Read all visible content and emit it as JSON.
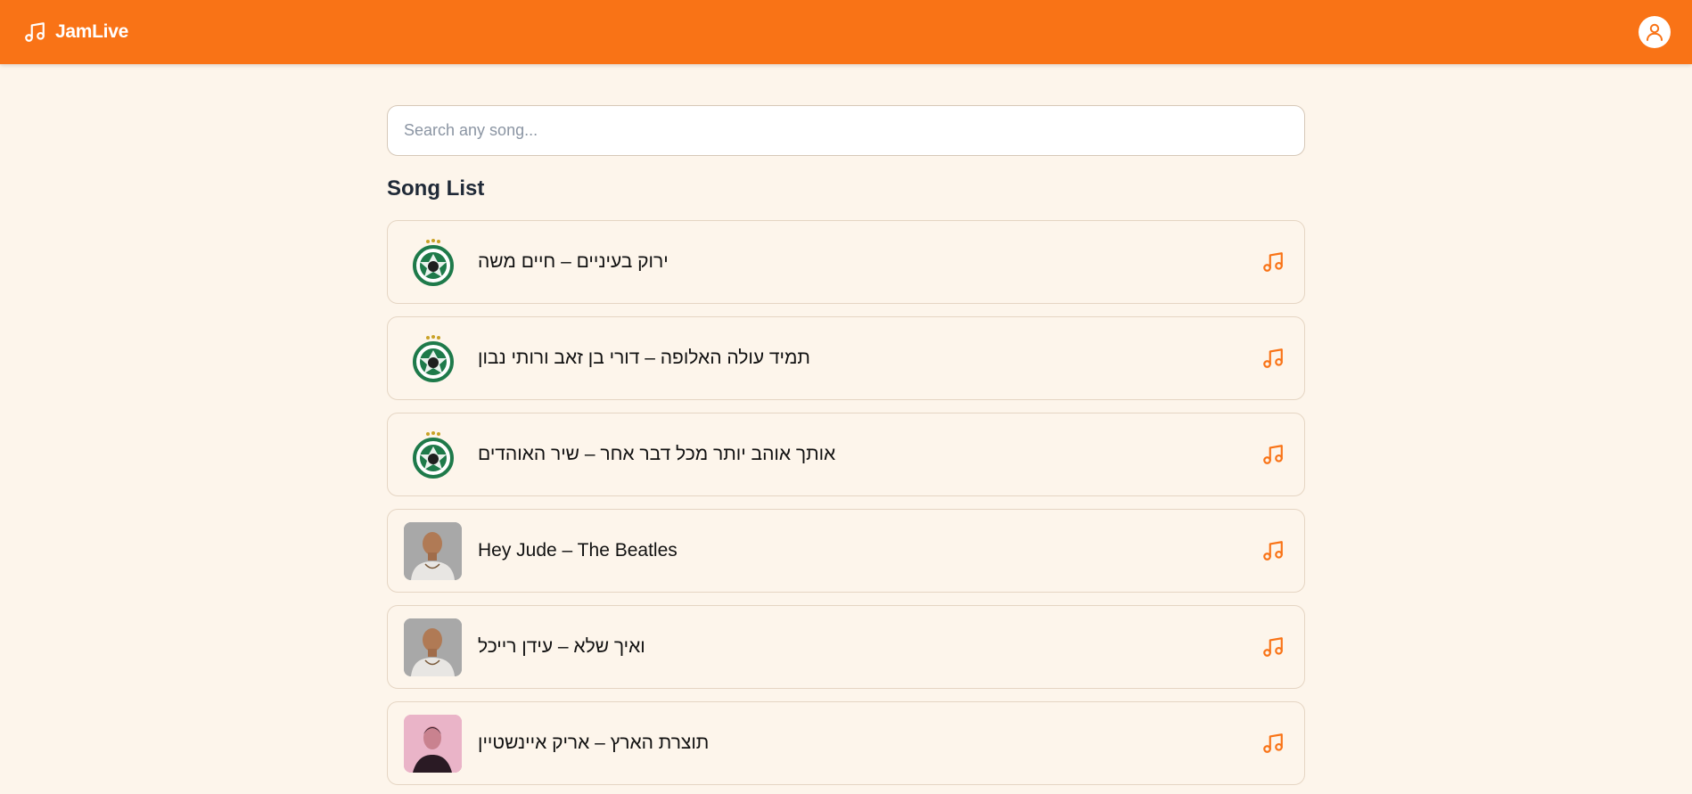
{
  "app": {
    "name": "JamLive",
    "brand_icon": "music-note-icon",
    "user_icon": "user-icon"
  },
  "colors": {
    "header": "#f97316",
    "background": "#fdf5eb",
    "accent": "#f97316",
    "card_border": "#e5d5c3"
  },
  "search": {
    "placeholder": "Search any song...",
    "value": ""
  },
  "song_list": {
    "title": "Song List",
    "items": [
      {
        "title": "ירוק בעיניים – חיים משה",
        "thumb": "club-logo"
      },
      {
        "title": "תמיד עולה האלופה – דורי בן זאב ורותי נבון",
        "thumb": "club-logo"
      },
      {
        "title": "אותך אוהב יותר מכל דבר אחר – שיר האוהדים",
        "thumb": "club-logo"
      },
      {
        "title": "Hey Jude – The Beatles",
        "thumb": "artist-photo"
      },
      {
        "title": "ואיך שלא – עידן רייכל",
        "thumb": "artist-photo"
      },
      {
        "title": "תוצרת הארץ – אריק איינשטיין",
        "thumb": "artist-photo"
      }
    ]
  }
}
